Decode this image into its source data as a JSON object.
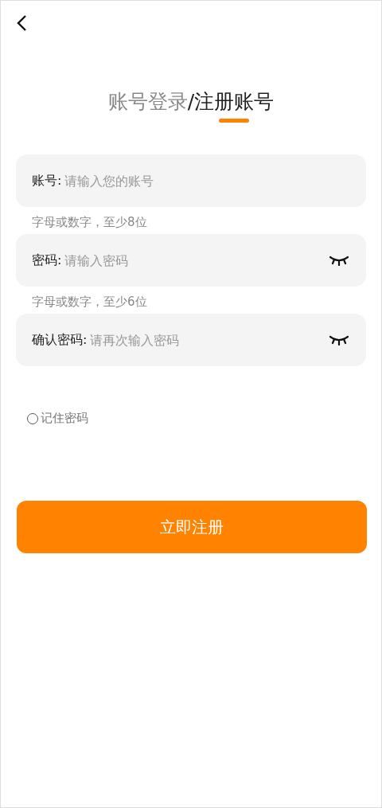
{
  "tabs": [
    {
      "label": "账号登录",
      "selected": false
    },
    {
      "label": "注册账号",
      "selected": true
    }
  ],
  "tab_separator": "/",
  "fields": [
    {
      "label": "账号:",
      "placeholder": "请输入您的账号",
      "hint": "字母或数字，至少8位",
      "kind": "text"
    },
    {
      "label": "密码:",
      "placeholder": "请输入密码",
      "hint": "字母或数字，至少6位",
      "kind": "password",
      "visible": false
    },
    {
      "label": "确认密码:",
      "placeholder": "请再次输入密码",
      "kind": "password",
      "visible": false
    }
  ],
  "remember": {
    "label": "记住密码",
    "checked": false
  },
  "submit": "立即注册"
}
